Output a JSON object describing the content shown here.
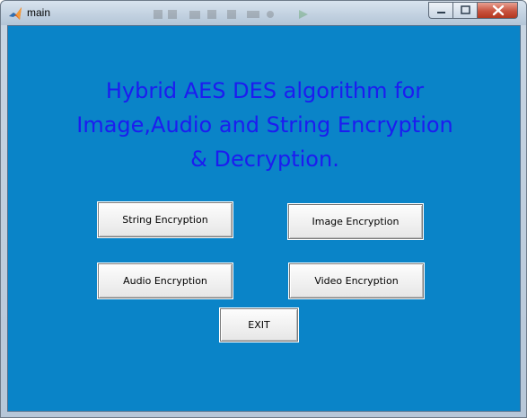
{
  "window": {
    "title": "main",
    "icon": "matlab-icon",
    "controls": [
      "minimize-icon",
      "maximize-icon",
      "close-icon"
    ]
  },
  "colors": {
    "background": "#0a84c8",
    "heading": "#1c1cf0"
  },
  "heading": {
    "line1": "Hybrid AES DES algorithm for",
    "line2": "Image,Audio and String Encryption",
    "line3": "& Decryption."
  },
  "buttons": {
    "string": "String Encryption",
    "image": "Image Encryption",
    "audio": "Audio Encryption",
    "video": "Video Encryption",
    "exit": "EXIT"
  }
}
